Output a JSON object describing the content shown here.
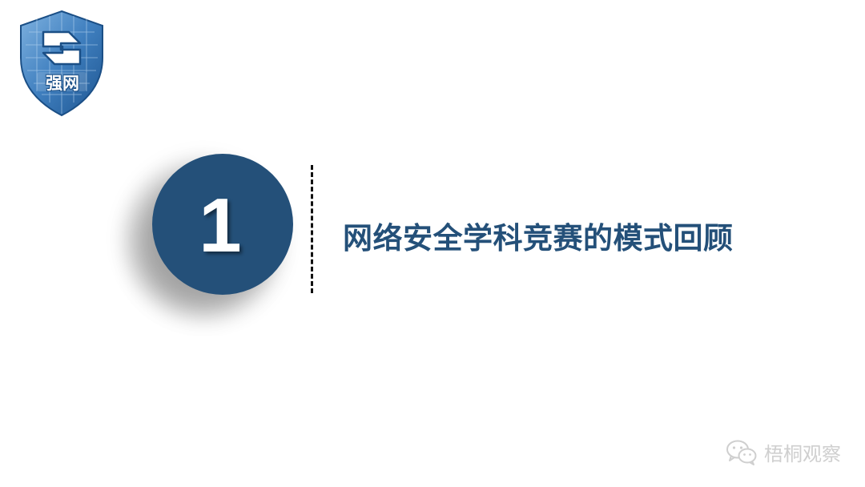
{
  "logo": {
    "text": "强网",
    "icon": "shield-logo-icon",
    "colors": {
      "shield": "#2d6ba8",
      "shield_light": "#6fa3d4",
      "text": "#ffffff"
    }
  },
  "section": {
    "number": "1",
    "title": "网络安全学科竞赛的模式回顾",
    "circle_color": "#245079",
    "title_color": "#245079"
  },
  "watermark": {
    "icon": "wechat-icon",
    "text": "梧桐观察",
    "color": "#cfcfcf"
  }
}
